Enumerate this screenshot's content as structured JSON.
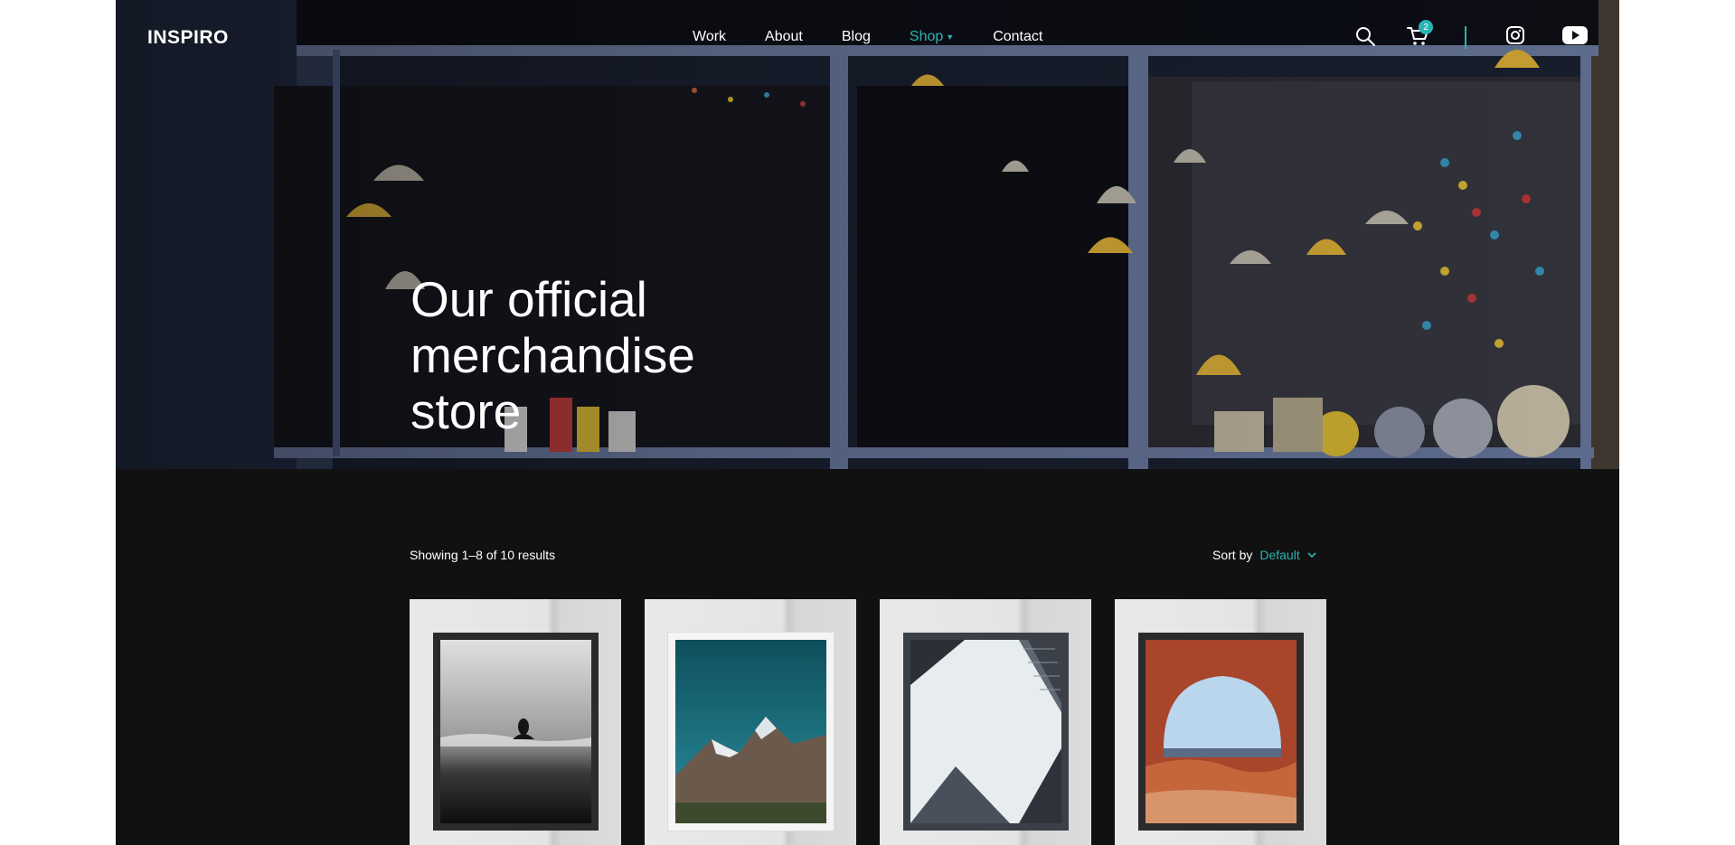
{
  "brand": {
    "logo_text": "INSPIRO",
    "accent_color": "#2ab4b4"
  },
  "nav": {
    "items": [
      {
        "label": "Work",
        "active": false
      },
      {
        "label": "About",
        "active": false
      },
      {
        "label": "Blog",
        "active": false
      },
      {
        "label": "Shop",
        "active": true
      },
      {
        "label": "Contact",
        "active": false
      }
    ],
    "cart_count": "2",
    "icons": [
      "search-icon",
      "cart-icon",
      "instagram-icon",
      "youtube-icon"
    ]
  },
  "hero": {
    "title_line1": "Our official",
    "title_line2": "merchandise",
    "title_line3": "store"
  },
  "shop": {
    "results_text": "Showing 1–8 of 10 results",
    "sort_label": "Sort by",
    "sort_value": "Default"
  },
  "products": [
    {
      "image": "black-and-white-swimmer-poster"
    },
    {
      "image": "snowy-mountain-poster"
    },
    {
      "image": "skyscrapers-looking-up-poster"
    },
    {
      "image": "red-rock-arch-poster"
    }
  ]
}
